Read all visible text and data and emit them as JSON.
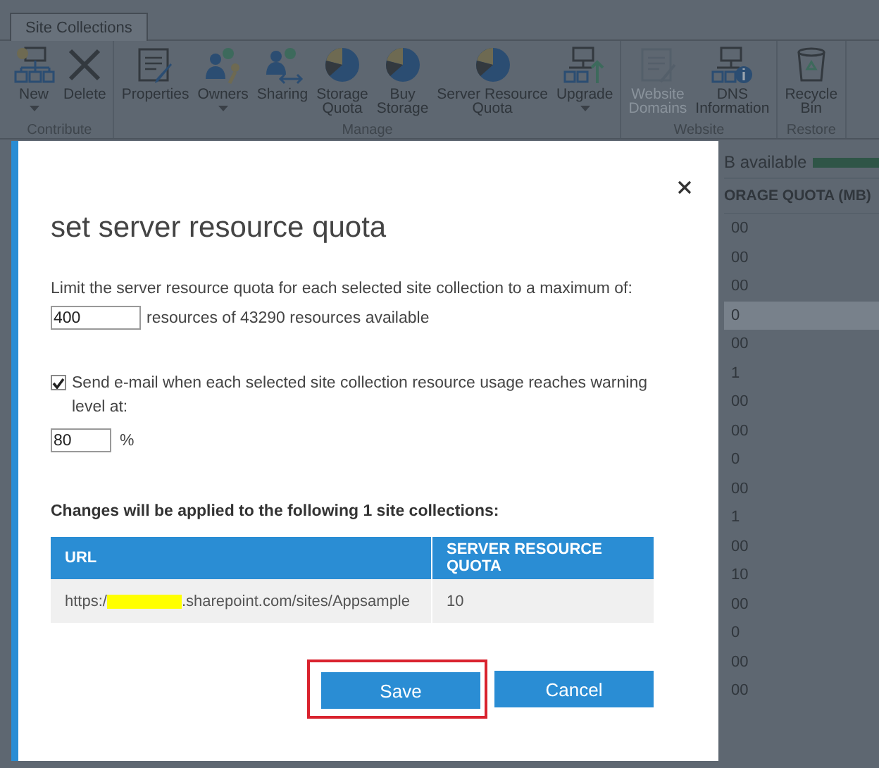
{
  "ribbon": {
    "tabs": [
      {
        "label": "Site Collections",
        "selected": true
      }
    ],
    "groups": [
      {
        "label": "Contribute",
        "buttons": [
          {
            "label": "New",
            "kind": "new",
            "dropdown": true,
            "disabled": false
          },
          {
            "label": "Delete",
            "kind": "delete",
            "dropdown": false,
            "disabled": false
          }
        ]
      },
      {
        "label": "Manage",
        "buttons": [
          {
            "label": "Properties",
            "kind": "properties",
            "dropdown": false,
            "disabled": false
          },
          {
            "label": "Owners",
            "kind": "owners",
            "dropdown": true,
            "disabled": false
          },
          {
            "label": "Sharing",
            "kind": "sharing",
            "dropdown": false,
            "disabled": false
          },
          {
            "label": "Storage\nQuota",
            "kind": "pie",
            "dropdown": false,
            "disabled": false
          },
          {
            "label": "Buy\nStorage",
            "kind": "pie",
            "dropdown": false,
            "disabled": false
          },
          {
            "label": "Server Resource\nQuota",
            "kind": "pie",
            "dropdown": false,
            "disabled": false
          },
          {
            "label": "Upgrade",
            "kind": "upgrade",
            "dropdown": true,
            "disabled": false
          }
        ]
      },
      {
        "label": "Website",
        "buttons": [
          {
            "label": "Website\nDomains",
            "kind": "domains",
            "dropdown": false,
            "disabled": true
          },
          {
            "label": "DNS\nInformation",
            "kind": "dns",
            "dropdown": false,
            "disabled": false
          }
        ]
      },
      {
        "label": "Restore",
        "buttons": [
          {
            "label": "Recycle\nBin",
            "kind": "recycle",
            "dropdown": false,
            "disabled": false
          }
        ]
      }
    ]
  },
  "background_list": {
    "storage_text": "B available",
    "column_header": "ORAGE QUOTA (MB)",
    "rows": [
      {
        "cell": "00",
        "selected": false
      },
      {
        "cell": "00",
        "selected": false
      },
      {
        "cell": "00",
        "selected": false
      },
      {
        "cell": "0",
        "selected": true
      },
      {
        "cell": "00",
        "selected": false
      },
      {
        "cell": "1",
        "selected": false
      },
      {
        "cell": "00",
        "selected": false
      },
      {
        "cell": "00",
        "selected": false
      },
      {
        "cell": "0",
        "selected": false
      },
      {
        "cell": "00",
        "selected": false
      },
      {
        "cell": "1",
        "selected": false
      },
      {
        "cell": "00",
        "selected": false
      },
      {
        "cell": "10",
        "selected": false
      },
      {
        "cell": "00",
        "selected": false
      },
      {
        "cell": "0",
        "selected": false
      },
      {
        "cell": "00",
        "selected": false
      },
      {
        "cell": "00",
        "selected": false
      }
    ]
  },
  "dialog": {
    "title": "set server resource quota",
    "limit_label": "Limit the server resource quota for each selected site collection to a maximum of:",
    "limit": {
      "value": "400",
      "suffix": "resources of 43290 resources available"
    },
    "email_warning": {
      "checked": true,
      "label": "Send e-mail when each selected site collection resource usage reaches warning level at:",
      "value": "80",
      "unit": "%"
    },
    "changes_label": "Changes will be applied to the following 1 site collections:",
    "table": {
      "columns": [
        "URL",
        "SERVER RESOURCE QUOTA"
      ],
      "rows": [
        {
          "url": {
            "prefix": "https:/",
            "redacted": true,
            "suffix": ".sharepoint.com/sites/Appsample"
          },
          "quota": "10"
        }
      ]
    },
    "buttons": [
      {
        "label": "Save",
        "highlighted": true
      },
      {
        "label": "Cancel",
        "highlighted": false
      }
    ]
  }
}
